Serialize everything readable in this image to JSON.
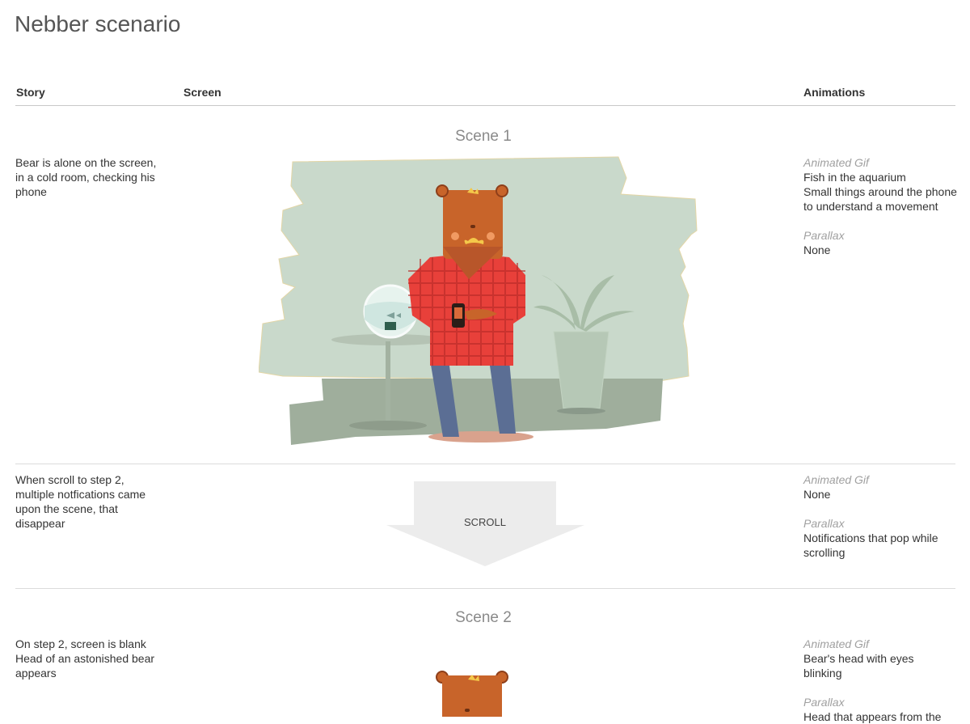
{
  "page": {
    "title": "Nebber scenario"
  },
  "headers": {
    "story": "Story",
    "screen": "Screen",
    "animations": "Animations"
  },
  "rows": [
    {
      "scene_title": "Scene 1",
      "story": "Bear is alone on the screen,\nin a cold room, checking his\nphone",
      "gif_label": "Animated Gif",
      "gif_lines": [
        "Fish in the aquarium",
        "Small things around the phone",
        "to understand a movement"
      ],
      "parallax_label": "Parallax",
      "parallax_lines": [
        "None"
      ]
    },
    {
      "story": "When scroll to step 2,\nmultiple notfications came\nupon the scene, that\ndisappear",
      "scroll_label": "SCROLL",
      "gif_label": "Animated Gif",
      "gif_lines": [
        "None"
      ],
      "parallax_label": "Parallax",
      "parallax_lines": [
        "Notifications that pop while",
        "scrolling"
      ]
    },
    {
      "scene_title": "Scene 2",
      "story": "On step 2, screen is blank\nHead of an astonished bear\nappears",
      "gif_label": "Animated Gif",
      "gif_lines": [
        "Bear's head with eyes",
        "blinking"
      ],
      "parallax_label": "Parallax",
      "parallax_lines": [
        "Head that appears from the"
      ]
    }
  ],
  "colors": {
    "wall": "#c9d9cb",
    "floor": "#9fae9c",
    "fur": "#c8642a",
    "shirt": "#e8403a",
    "jeans": "#5b6e94",
    "arrow": "#ececec"
  }
}
